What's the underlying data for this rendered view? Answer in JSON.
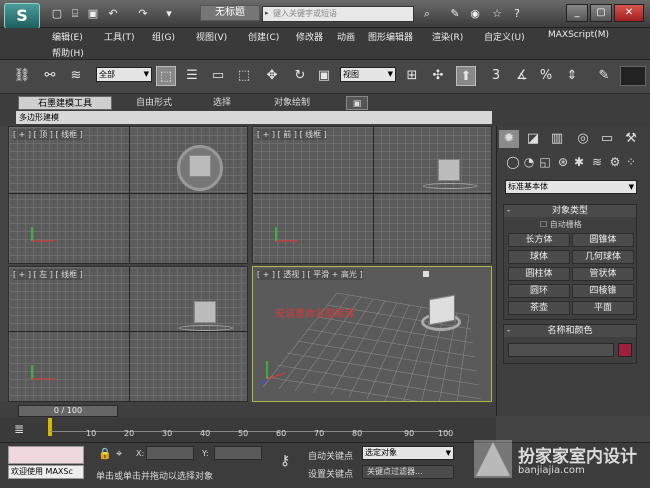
{
  "app": {
    "title": "无标题",
    "search_placeholder": "键入关键字或短语"
  },
  "menu": [
    "编辑(E)",
    "工具(T)",
    "组(G)",
    "视图(V)",
    "创建(C)",
    "修改器",
    "动画",
    "图形编辑器",
    "渲染(R)",
    "自定义(U)",
    "MAXScript(M)",
    "帮助(H)"
  ],
  "toolbar": {
    "selection_filter": "全部",
    "ref_coord": "视图",
    "percent_snap": "%"
  },
  "ribbon": {
    "tabs": [
      "石墨建模工具",
      "自由形式",
      "选择",
      "对象绘制"
    ],
    "sub": "多边形建模"
  },
  "viewports": {
    "top": "[ + ] [ 顶 ] [ 线框 ]",
    "front": "[ + ] [ 前 ] [ 线框 ]",
    "left": "[ + ] [ 左 ] [ 线框 ]",
    "persp": "[ + ] [ 透视 ] [ 平滑 + 高光 ]",
    "persp_annotation": "安装重命名图案库",
    "accent_color": "#d23a3a"
  },
  "command_panel": {
    "category": "标准基本体",
    "object_type": {
      "title": "对象类型",
      "autogrid": "自动栅格",
      "buttons": [
        "长方体",
        "圆锥体",
        "球体",
        "几何球体",
        "圆柱体",
        "管状体",
        "圆环",
        "四棱锥",
        "茶壶",
        "平面"
      ]
    },
    "name_color": {
      "title": "名称和颜色",
      "swatch": "#a01f3c"
    }
  },
  "timeline": {
    "frame_display": "0 / 100",
    "ticks": [
      "10",
      "20",
      "30",
      "40",
      "50",
      "60",
      "70",
      "80",
      "90",
      "100"
    ]
  },
  "status": {
    "welcome": "欢迎使用 MAXSc",
    "prompt": "单击或单击并拖动以选择对象",
    "x_label": "X:",
    "y_label": "Y:",
    "autokey": "自动关键点",
    "setkey": "设置关键点",
    "selected": "选定对象",
    "key_filters": "关键点过滤器..."
  },
  "watermark": {
    "main": "扮家家室内设计",
    "sub": "banjiajia.com"
  }
}
